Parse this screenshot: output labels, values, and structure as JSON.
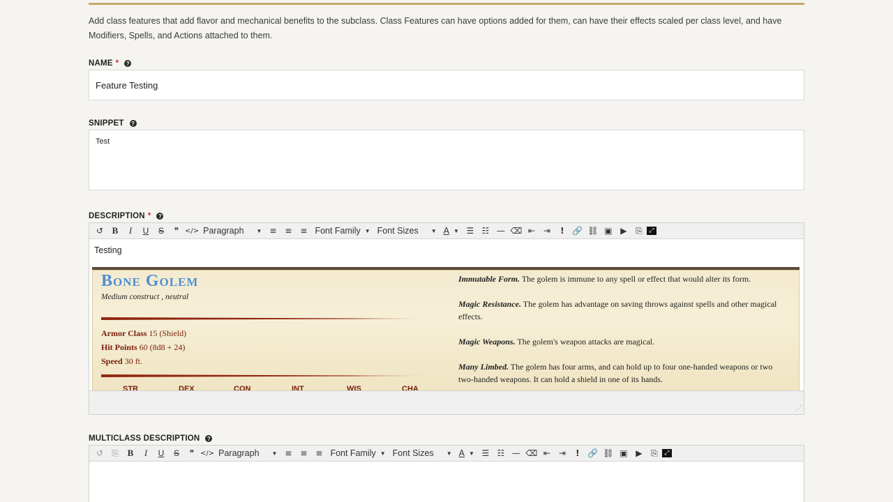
{
  "intro": "Add class features that add flavor and mechanical benefits to the subclass. Class Features can have options added for them, can have their effects scaled per class level, and have Modifiers, Spells, and Actions attached to them.",
  "name_field": {
    "label": "NAME",
    "required_mark": "*",
    "value": "Feature Testing"
  },
  "snippet_field": {
    "label": "SNIPPET",
    "value": "Test"
  },
  "description_field": {
    "label": "DESCRIPTION",
    "required_mark": "*",
    "text": "Testing"
  },
  "multiclass_field": {
    "label": "MULTICLASS DESCRIPTION"
  },
  "toolbar": {
    "undo": "↺",
    "bold": "B",
    "italic": "I",
    "underline": "U",
    "strike": "S",
    "quote": "❞",
    "code": "</>",
    "format": "Paragraph",
    "font_family": "Font Family",
    "font_sizes": "Font Sizes",
    "text_color": "A",
    "hr": "—",
    "exclaim": "!"
  },
  "statblock": {
    "name": "Bone Golem",
    "type": "Medium construct , neutral",
    "props": [
      {
        "key": "Armor Class",
        "value": "15 (Shield)"
      },
      {
        "key": "Hit Points",
        "value": "60 (8d8 + 24)"
      },
      {
        "key": "Speed",
        "value": "30 ft."
      }
    ],
    "abilities": [
      "STR",
      "DEX",
      "CON",
      "INT",
      "WIS",
      "CHA"
    ],
    "traits": [
      {
        "name": "Immutable Form.",
        "text": "The golem is immune to any spell or effect that would alter its form."
      },
      {
        "name": "Magic Resistance.",
        "text": "The golem has advantage on saving throws against spells and other magical effects."
      },
      {
        "name": "Magic Weapons.",
        "text": "The golem's weapon attacks are magical."
      },
      {
        "name": "Many Limbed.",
        "text": "The golem has four arms, and can hold up to four one-handed weapons or two two-handed weapons. It can hold a shield in one of its hands."
      }
    ]
  },
  "colors": {
    "accent_gold": "#c8a86b",
    "required": "#c53131",
    "statblock_red": "#922610",
    "statblock_title": "#4e8fd1"
  }
}
